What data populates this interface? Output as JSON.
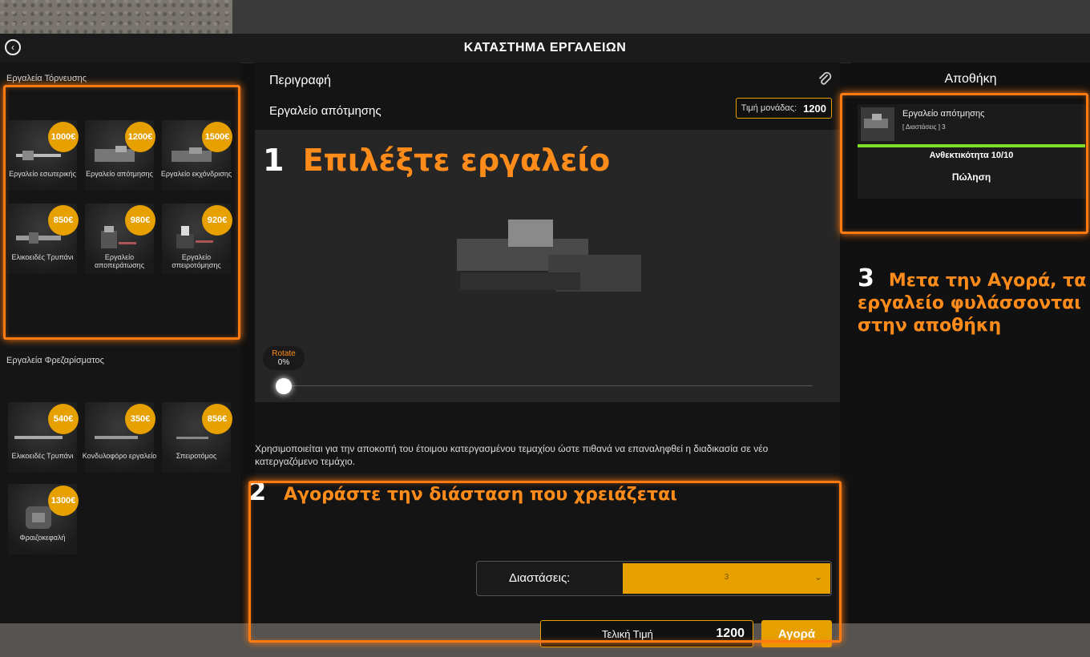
{
  "window": {
    "title": "ΚΑΤΑΣΤΗΜΑ ΕΡΓΑΛΕΙΩΝ"
  },
  "left": {
    "turning_label": "Εργαλεία Τόρνευσης",
    "turning_tools": [
      {
        "price": "1000€",
        "name": "Εργαλείο εσωτερικής"
      },
      {
        "price": "1200€",
        "name": "Εργαλείο απότμησης"
      },
      {
        "price": "1500€",
        "name": "Εργαλείο εκχόνδρισης"
      },
      {
        "price": "850€",
        "name": "Ελικοειδές Τρυπάνι"
      },
      {
        "price": "980€",
        "name": "Εργαλείο αποπεράτωσης"
      },
      {
        "price": "920€",
        "name": "Εργαλείο σπειροτόμησης"
      }
    ],
    "milling_label": "Εργαλεία Φρεζαρίσματος",
    "milling_tools": [
      {
        "price": "540€",
        "name": "Ελικοειδές Τρυπάνι"
      },
      {
        "price": "350€",
        "name": "Κονδυλοφόρο εργαλείο"
      },
      {
        "price": "856€",
        "name": "Σπειροτόμος"
      },
      {
        "price": "1300€",
        "name": "Φραιζοκεφαλή"
      }
    ]
  },
  "center": {
    "description_heading": "Περιγραφή",
    "tool_title": "Εργαλείο απότμησης",
    "unit_price_label": "Τιμή μονάδας:",
    "unit_price_value": "1200",
    "step1_num": "1",
    "step1_text": "Επιλέξτε εργαλείο",
    "rotate_label": "Rotate",
    "rotate_value": "0%",
    "description": "Χρησιμοποιείται για την αποκοπή του έτοιμου κατεργασμένου τεμαχίου ώστε πιθανά να επαναληφθεί η διαδικασία σε νέο κατεργαζόμενο τεμάχιο.",
    "step2_num": "2",
    "step2_text": "Αγοράστε την διάσταση που χρειάζεται",
    "dimensions_label": "Διαστάσεις:",
    "dimensions_value": "3",
    "total_label": "Τελική Τιμή",
    "total_value": "1200",
    "buy_label": "Αγορά"
  },
  "warehouse": {
    "title": "Αποθήκη",
    "item_name": "Εργαλείο απότμησης",
    "item_dim": "[ Διαστάσεις ]      3",
    "durability": "Ανθεκτικότητα 10/10",
    "sell_label": "Πώληση",
    "step3_num": "3",
    "step3_text": "Μετα την Αγορά, τα εργαλείο φυλάσσονται στην αποθήκη"
  },
  "colors": {
    "accent": "#e6a000",
    "highlight": "#ff7a10",
    "durability": "#7ee02a"
  }
}
